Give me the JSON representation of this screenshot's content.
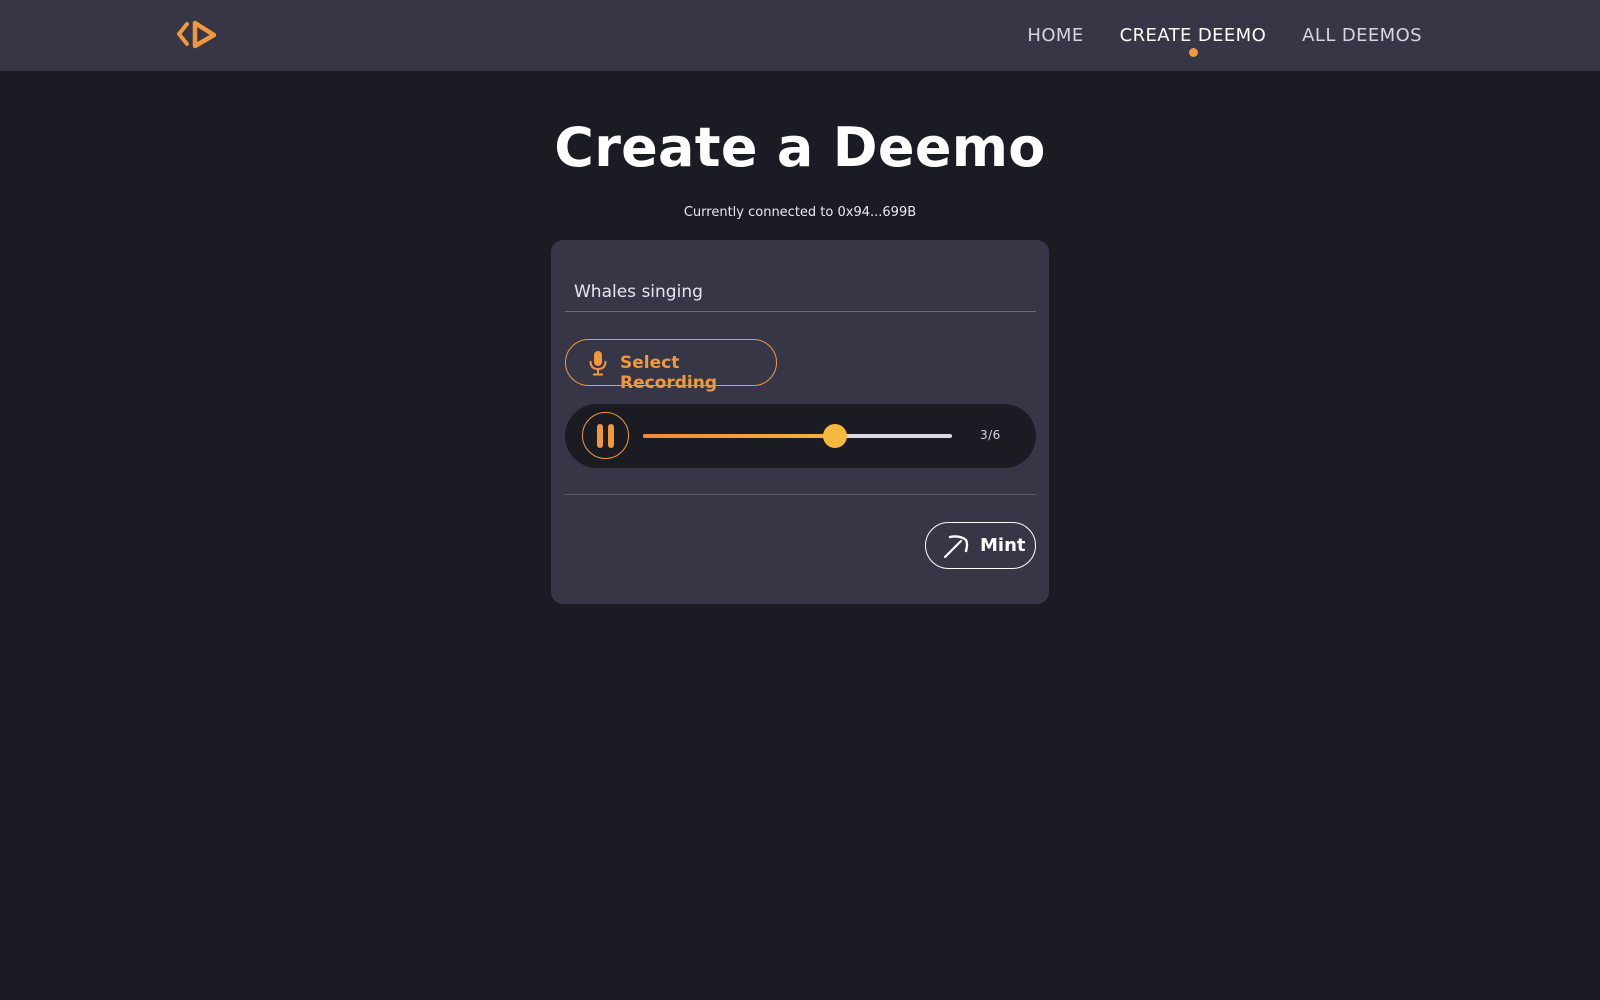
{
  "nav": {
    "logo_icon": "deemo-logo-icon",
    "links": [
      {
        "label": "HOME",
        "active": false
      },
      {
        "label": "CREATE DEEMO",
        "active": true
      },
      {
        "label": "ALL DEEMOS",
        "active": false
      }
    ]
  },
  "page": {
    "title": "Create a Deemo",
    "connected_text": "Currently connected to 0x94...699B"
  },
  "form": {
    "title_value": "Whales singing",
    "select_recording_label": "Select Recording",
    "select_recording_icon": "microphone-icon",
    "player": {
      "state_icon": "pause-icon",
      "progress": 0.62,
      "time_label": "3/6"
    },
    "mint_label": "Mint",
    "mint_icon": "pickaxe-icon"
  },
  "colors": {
    "accent": "#f0983d",
    "accent_light": "#f6b93f",
    "background": "#1b1b23",
    "surface": "#373646"
  }
}
